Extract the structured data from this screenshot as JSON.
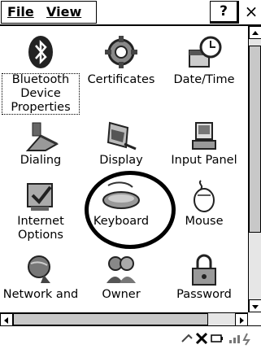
{
  "menubar": {
    "file_label": "File",
    "view_label": "View",
    "help_label": "?",
    "close_label": "×"
  },
  "items": [
    {
      "label": "Bluetooth\nDevice\nProperties",
      "icon": "bluetooth-icon"
    },
    {
      "label": "Certificates",
      "icon": "certificates-icon"
    },
    {
      "label": "Date/Time",
      "icon": "date-time-icon"
    },
    {
      "label": "Dialing",
      "icon": "dialing-icon"
    },
    {
      "label": "Display",
      "icon": "display-icon"
    },
    {
      "label": "Input Panel",
      "icon": "input-panel-icon"
    },
    {
      "label": "Internet\nOptions",
      "icon": "internet-options-icon"
    },
    {
      "label": "Keyboard",
      "icon": "keyboard-icon"
    },
    {
      "label": "Mouse",
      "icon": "mouse-icon"
    },
    {
      "label": "Network and",
      "icon": "network-icon"
    },
    {
      "label": "Owner",
      "icon": "owner-icon"
    },
    {
      "label": "Password",
      "icon": "password-icon"
    }
  ],
  "scrollbar_icons": {
    "up": "arrow-up-icon",
    "down": "arrow-down-icon",
    "left": "arrow-left-icon",
    "right": "arrow-right-icon"
  },
  "statusbar": {
    "icons": [
      "connection-icon",
      "wireless-off-icon",
      "battery-icon",
      "signal-icon",
      "power-icon"
    ]
  }
}
